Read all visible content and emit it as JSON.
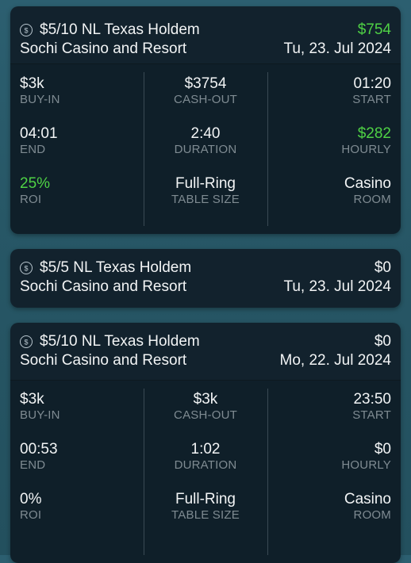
{
  "sessions": [
    {
      "title": "$5/10 NL Texas Holdem",
      "venue": "Sochi Casino and Resort",
      "profit": "$754",
      "profit_color": "#4fd245",
      "date": "Tu, 23. Jul 2024",
      "stats": {
        "buy_in": {
          "value": "$3k",
          "label": "BUY-IN"
        },
        "cash_out": {
          "value": "$3754",
          "label": "CASH-OUT"
        },
        "start": {
          "value": "01:20",
          "label": "START"
        },
        "end": {
          "value": "04:01",
          "label": "END"
        },
        "duration": {
          "value": "2:40",
          "label": "DURATION"
        },
        "hourly": {
          "value": "$282",
          "label": "HOURLY"
        },
        "roi": {
          "value": "25%",
          "label": "ROI"
        },
        "table_size": {
          "value": "Full-Ring",
          "label": "TABLE SIZE"
        },
        "room": {
          "value": "Casino",
          "label": "ROOM"
        }
      }
    },
    {
      "title": "$5/5 NL Texas Holdem",
      "venue": "Sochi Casino and Resort",
      "profit": "$0",
      "date": "Tu, 23. Jul 2024"
    },
    {
      "title": "$5/10 NL Texas Holdem",
      "venue": "Sochi Casino and Resort",
      "profit": "$0",
      "date": "Mo, 22. Jul 2024",
      "stats": {
        "buy_in": {
          "value": "$3k",
          "label": "BUY-IN"
        },
        "cash_out": {
          "value": "$3k",
          "label": "CASH-OUT"
        },
        "start": {
          "value": "23:50",
          "label": "START"
        },
        "end": {
          "value": "00:53",
          "label": "END"
        },
        "duration": {
          "value": "1:02",
          "label": "DURATION"
        },
        "hourly": {
          "value": "$0",
          "label": "HOURLY"
        },
        "roi": {
          "value": "0%",
          "label": "ROI"
        },
        "table_size": {
          "value": "Full-Ring",
          "label": "TABLE SIZE"
        },
        "room": {
          "value": "Casino",
          "label": "ROOM"
        }
      }
    }
  ],
  "icons": {
    "currency": "dollar-coin-icon"
  },
  "colors": {
    "positive": "#4fd245",
    "label": "#7f8b92",
    "card_bg": "#0f1f29"
  }
}
